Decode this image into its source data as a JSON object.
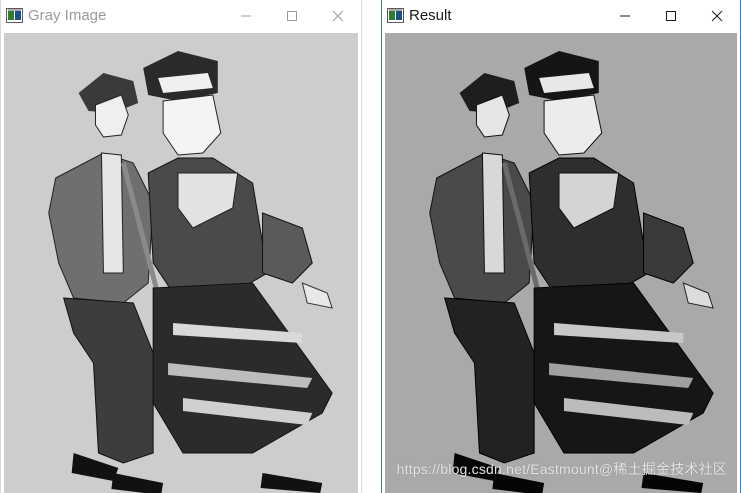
{
  "windows": [
    {
      "title": "Gray Image",
      "active": false,
      "controls": {
        "minimize": "minimize-icon",
        "maximize": "maximize-icon",
        "close": "close-icon"
      }
    },
    {
      "title": "Result",
      "active": true,
      "controls": {
        "minimize": "minimize-icon",
        "maximize": "maximize-icon",
        "close": "close-icon"
      }
    }
  ],
  "watermark": "https://blog.csdn.net/Eastmount",
  "watermark_cn": "@稀土掘金技术社区",
  "colors": {
    "left_background": "#cdcdcd",
    "right_background": "#a9a9a9",
    "active_border": "#3c7fc0",
    "inactive_title": "#9a9a9a"
  },
  "image_description_icons": {
    "left_image": "grayscale-illustration-icon",
    "right_image": "processed-illustration-icon"
  }
}
